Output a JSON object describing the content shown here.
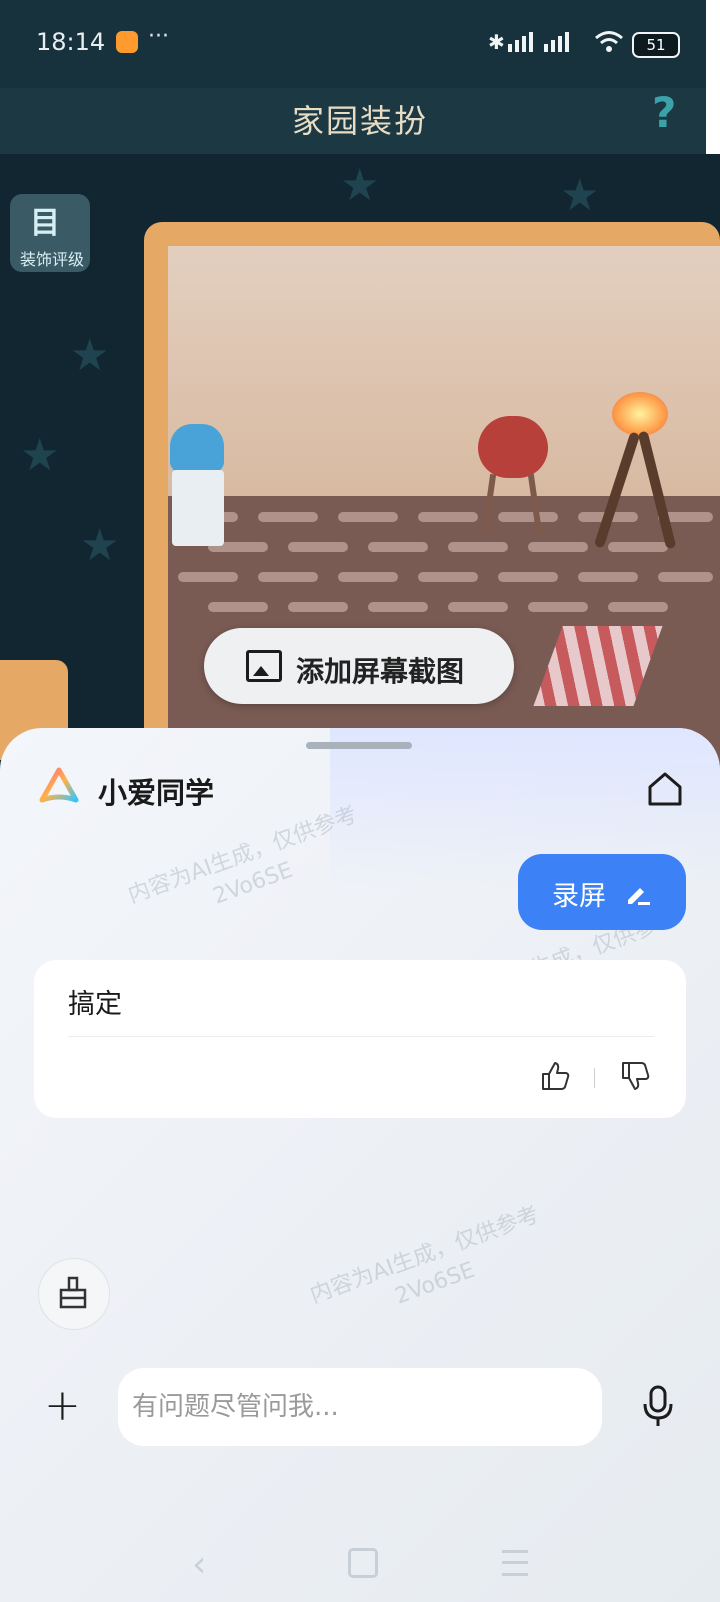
{
  "status_bar": {
    "time": "18:14",
    "dots": "···",
    "battery": "51"
  },
  "game": {
    "title": "家园装扮",
    "help_icon": "question-mark-icon",
    "decoration_rating_label": "装饰评级"
  },
  "screenshot_pill": {
    "label": "添加屏幕截图",
    "icon": "image-icon"
  },
  "assistant": {
    "name": "小爱同学",
    "logo_icon": "xiaoai-logo-icon",
    "home_icon": "home-icon",
    "user_message": "录屏",
    "reply_text": "搞定",
    "watermark_line1": "内容为AI生成，仅供参考",
    "watermark_line2": "2Vo6SE",
    "input_placeholder": "有问题尽管问我...",
    "colors": {
      "accent": "#3c82f6"
    }
  }
}
